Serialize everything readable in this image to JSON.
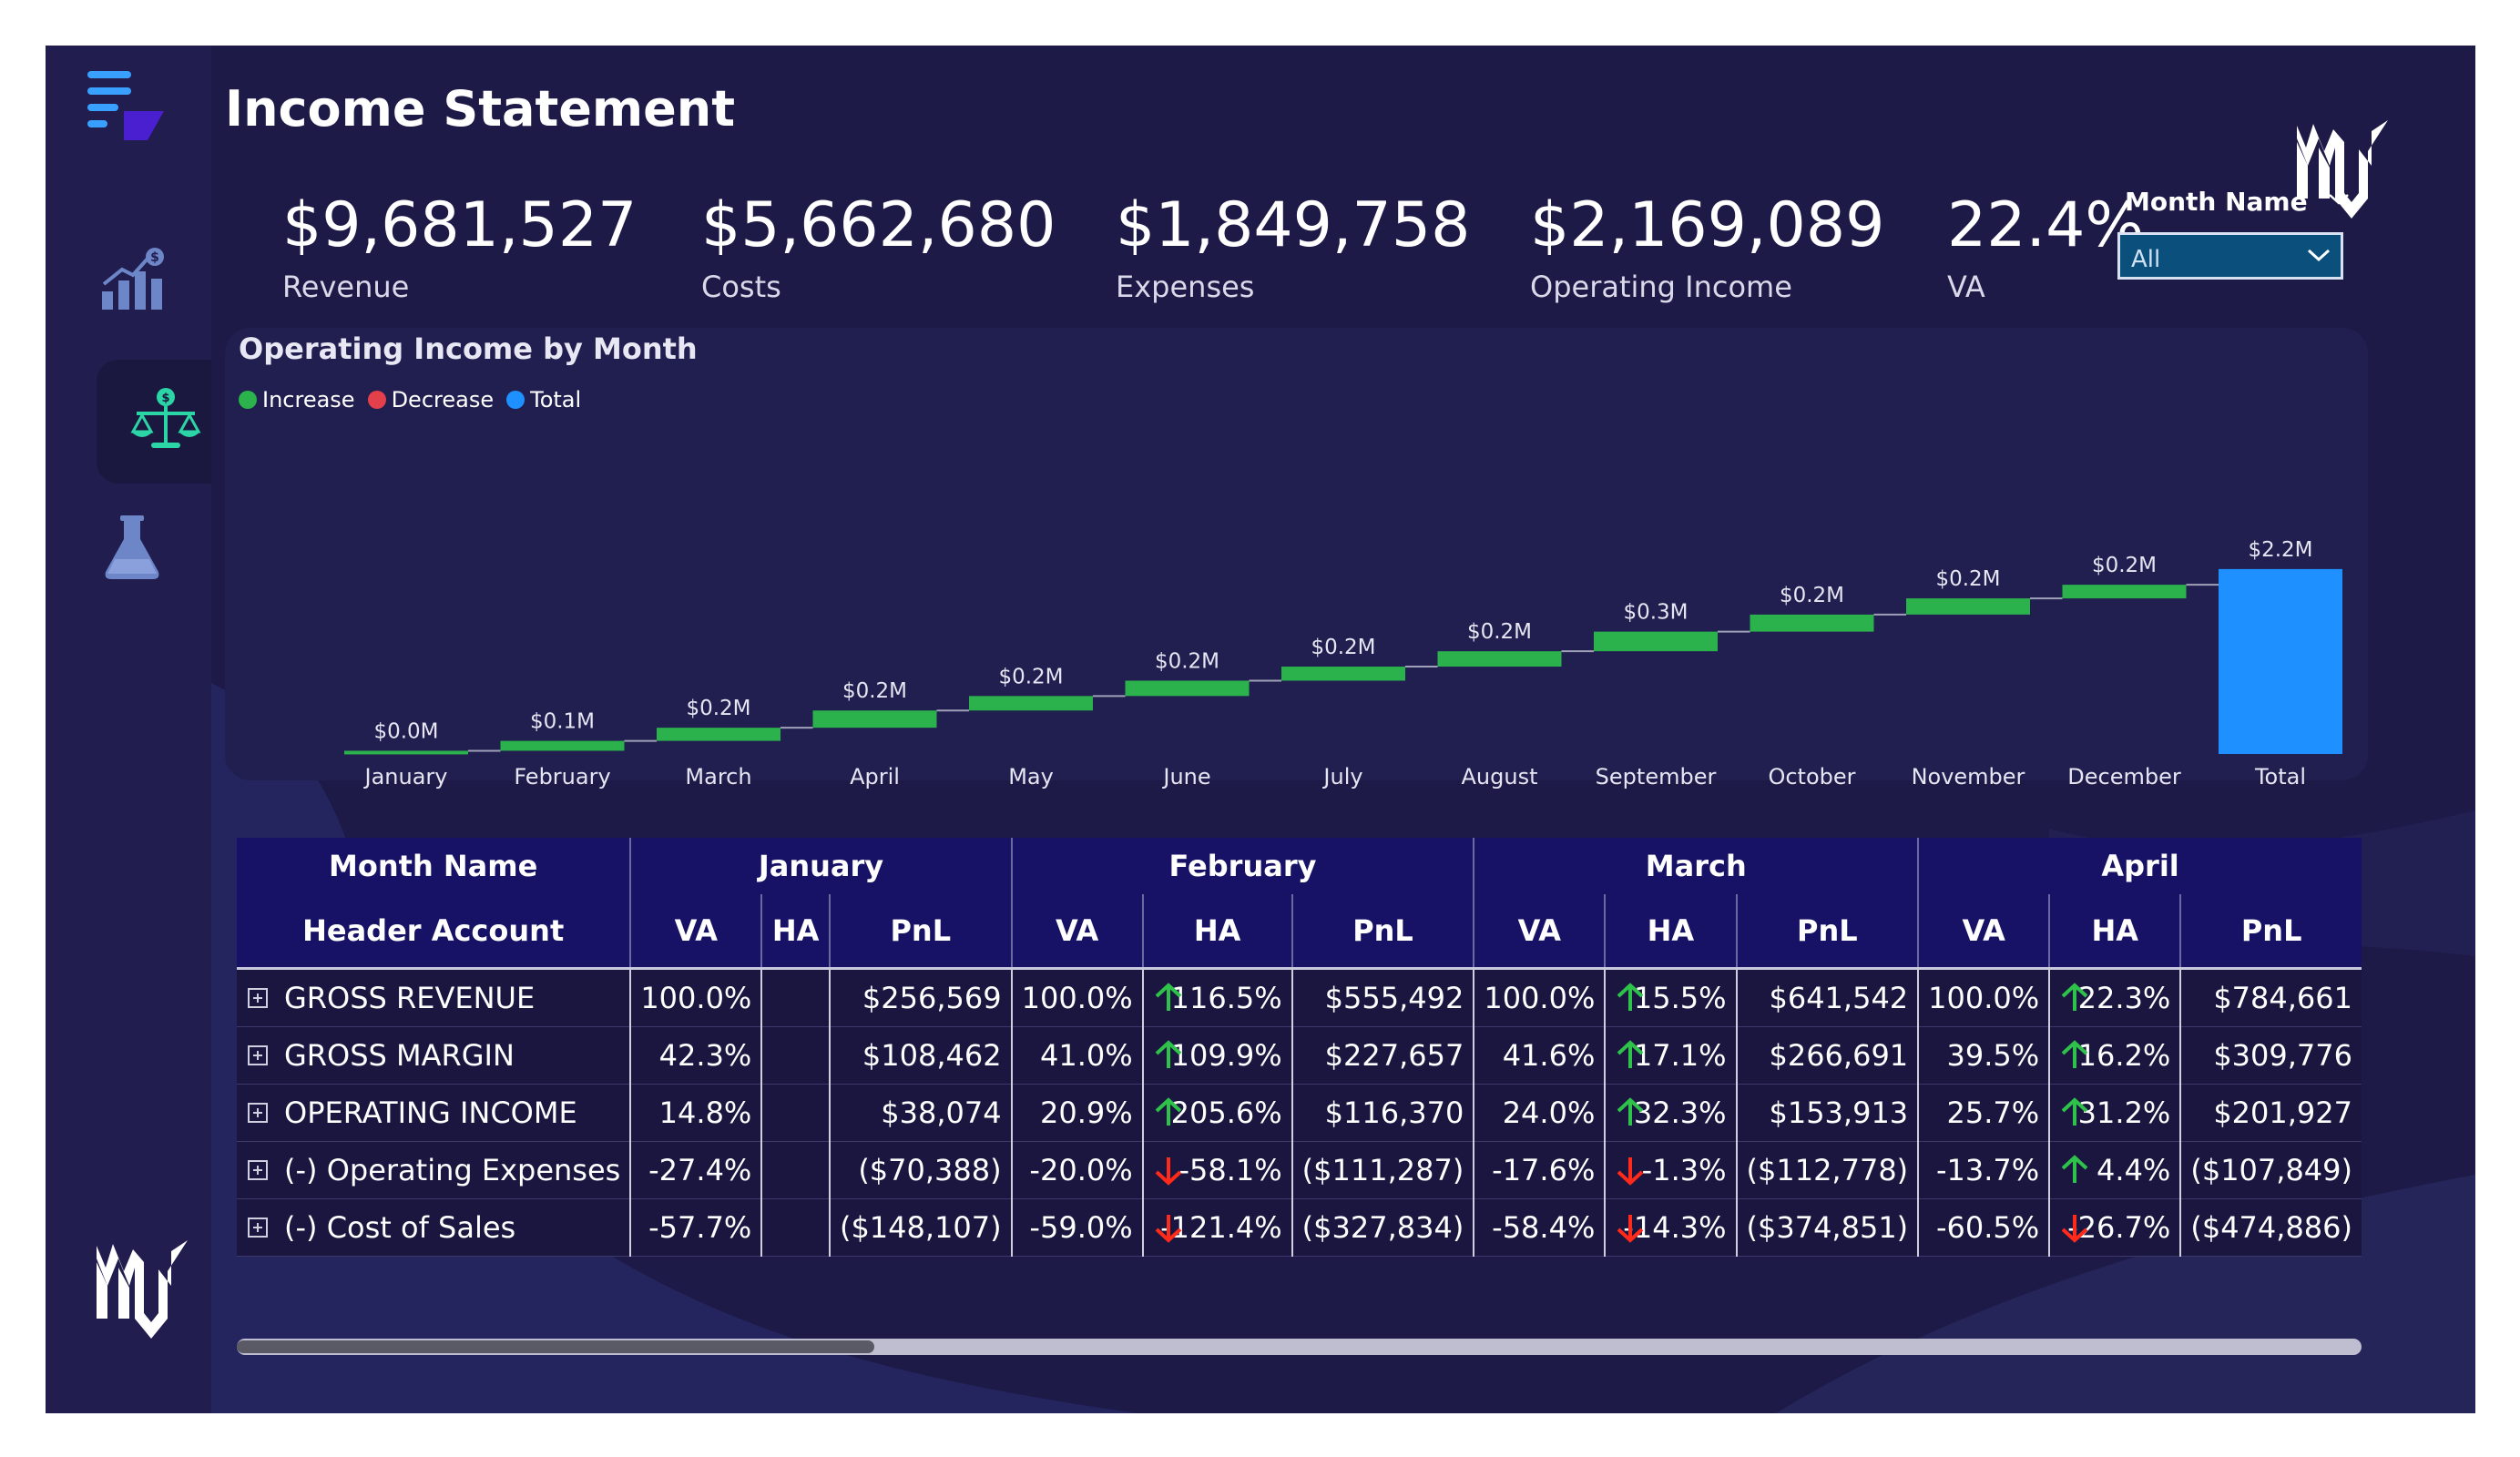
{
  "page_title": "Income Statement",
  "brand": {
    "mark": "MK"
  },
  "colors": {
    "background": "#1e1a47",
    "sidebar": "#211d4e",
    "card": "#211e50",
    "increase": "#2bb24c",
    "decrease": "#e3404c",
    "total": "#1e90ff",
    "up_arrow": "#2ec24a",
    "down_arrow": "#ff2a1a",
    "table_header": "#171265"
  },
  "sidebar": {
    "items": [
      {
        "name": "menu",
        "icon": "menu-icon",
        "active": false
      },
      {
        "name": "analytics",
        "icon": "chart-growth-icon",
        "active": false
      },
      {
        "name": "income-statement",
        "icon": "balance-scale-icon",
        "active": true
      },
      {
        "name": "lab",
        "icon": "flask-icon",
        "active": false
      }
    ]
  },
  "kpis": [
    {
      "value": "$9,681,527",
      "label": "Revenue"
    },
    {
      "value": "$5,662,680",
      "label": "Costs"
    },
    {
      "value": "$1,849,758",
      "label": "Expenses"
    },
    {
      "value": "$2,169,089",
      "label": "Operating Income"
    },
    {
      "value": "22.4%",
      "label": "VA"
    }
  ],
  "slicer": {
    "label": "Month Name",
    "value": "All"
  },
  "chart_title": "Operating Income by Month",
  "legend": [
    {
      "label": "Increase",
      "color": "#2bb24c"
    },
    {
      "label": "Decrease",
      "color": "#e3404c"
    },
    {
      "label": "Total",
      "color": "#1e90ff"
    }
  ],
  "chart_data": {
    "type": "bar",
    "subtype": "waterfall",
    "title": "Operating Income by Month",
    "categories": [
      "January",
      "February",
      "March",
      "April",
      "May",
      "June",
      "July",
      "August",
      "September",
      "October",
      "November",
      "December",
      "Total"
    ],
    "values": [
      0.038,
      0.116,
      0.154,
      0.202,
      0.17,
      0.18,
      0.165,
      0.18,
      0.23,
      0.2,
      0.19,
      0.16,
      2.169
    ],
    "data_labels": [
      "$0.0M",
      "$0.1M",
      "$0.2M",
      "$0.2M",
      "$0.2M",
      "$0.2M",
      "$0.2M",
      "$0.2M",
      "$0.3M",
      "$0.2M",
      "$0.2M",
      "$0.2M",
      "$2.2M"
    ],
    "kinds": [
      "increase",
      "increase",
      "increase",
      "increase",
      "increase",
      "increase",
      "increase",
      "increase",
      "increase",
      "increase",
      "increase",
      "increase",
      "total"
    ],
    "unit": "$M",
    "ylim": [
      0,
      2.2
    ],
    "legend_position": "top-left",
    "grid": false
  },
  "table": {
    "corner_top": "Month Name",
    "corner_bottom": "Header Account",
    "months": [
      "January",
      "February",
      "March",
      "April"
    ],
    "subcols": [
      "VA",
      "HA",
      "PnL"
    ],
    "rows": [
      {
        "account": "GROSS REVENUE",
        "cells": [
          {
            "va": "100.0%",
            "ha": "",
            "dir": "",
            "pnl": "$256,569"
          },
          {
            "va": "100.0%",
            "ha": "116.5%",
            "dir": "up",
            "pnl": "$555,492"
          },
          {
            "va": "100.0%",
            "ha": "15.5%",
            "dir": "up",
            "pnl": "$641,542"
          },
          {
            "va": "100.0%",
            "ha": "22.3%",
            "dir": "up",
            "pnl": "$784,661"
          }
        ]
      },
      {
        "account": "GROSS MARGIN",
        "cells": [
          {
            "va": "42.3%",
            "ha": "",
            "dir": "",
            "pnl": "$108,462"
          },
          {
            "va": "41.0%",
            "ha": "109.9%",
            "dir": "up",
            "pnl": "$227,657"
          },
          {
            "va": "41.6%",
            "ha": "17.1%",
            "dir": "up",
            "pnl": "$266,691"
          },
          {
            "va": "39.5%",
            "ha": "16.2%",
            "dir": "up",
            "pnl": "$309,776"
          }
        ]
      },
      {
        "account": "OPERATING INCOME",
        "cells": [
          {
            "va": "14.8%",
            "ha": "",
            "dir": "",
            "pnl": "$38,074"
          },
          {
            "va": "20.9%",
            "ha": "205.6%",
            "dir": "up",
            "pnl": "$116,370"
          },
          {
            "va": "24.0%",
            "ha": "32.3%",
            "dir": "up",
            "pnl": "$153,913"
          },
          {
            "va": "25.7%",
            "ha": "31.2%",
            "dir": "up",
            "pnl": "$201,927"
          }
        ]
      },
      {
        "account": "(-) Operating Expenses",
        "cells": [
          {
            "va": "-27.4%",
            "ha": "",
            "dir": "",
            "pnl": "($70,388)"
          },
          {
            "va": "-20.0%",
            "ha": "-58.1%",
            "dir": "down",
            "pnl": "($111,287)"
          },
          {
            "va": "-17.6%",
            "ha": "-1.3%",
            "dir": "down",
            "pnl": "($112,778)"
          },
          {
            "va": "-13.7%",
            "ha": "4.4%",
            "dir": "up",
            "pnl": "($107,849)"
          }
        ]
      },
      {
        "account": "(-) Cost of Sales",
        "cells": [
          {
            "va": "-57.7%",
            "ha": "",
            "dir": "",
            "pnl": "($148,107)"
          },
          {
            "va": "-59.0%",
            "ha": "-121.4%",
            "dir": "down",
            "pnl": "($327,834)"
          },
          {
            "va": "-58.4%",
            "ha": "-14.3%",
            "dir": "down",
            "pnl": "($374,851)"
          },
          {
            "va": "-60.5%",
            "ha": "-26.7%",
            "dir": "down",
            "pnl": "($474,886)"
          }
        ]
      }
    ]
  },
  "scrollbar": {
    "position_fraction": 0.0,
    "visible_fraction": 0.3
  }
}
